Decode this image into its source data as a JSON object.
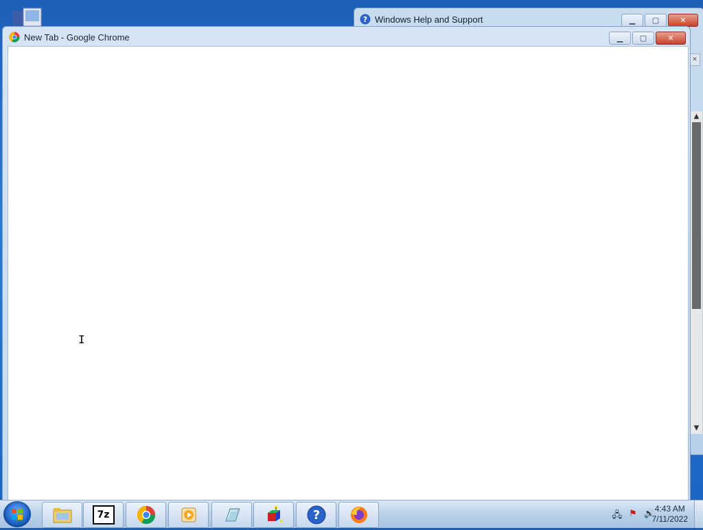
{
  "help_window": {
    "title": "Windows Help and Support"
  },
  "chrome_window": {
    "title": "New Tab - Google Chrome"
  },
  "taskbar": {
    "items": [
      "file-explorer",
      "7zip",
      "chrome",
      "media-player",
      "notepad",
      "3d-app",
      "help",
      "firefox"
    ],
    "seven_zip_label": "7z"
  },
  "clock": {
    "time": "4:43 AM",
    "date": "7/11/2022"
  },
  "cursor": {
    "glyph": "I"
  },
  "colors": {
    "desktop": "#1d5fb8",
    "close_button": "#c8432e",
    "chrome_content": "#ffffff"
  }
}
